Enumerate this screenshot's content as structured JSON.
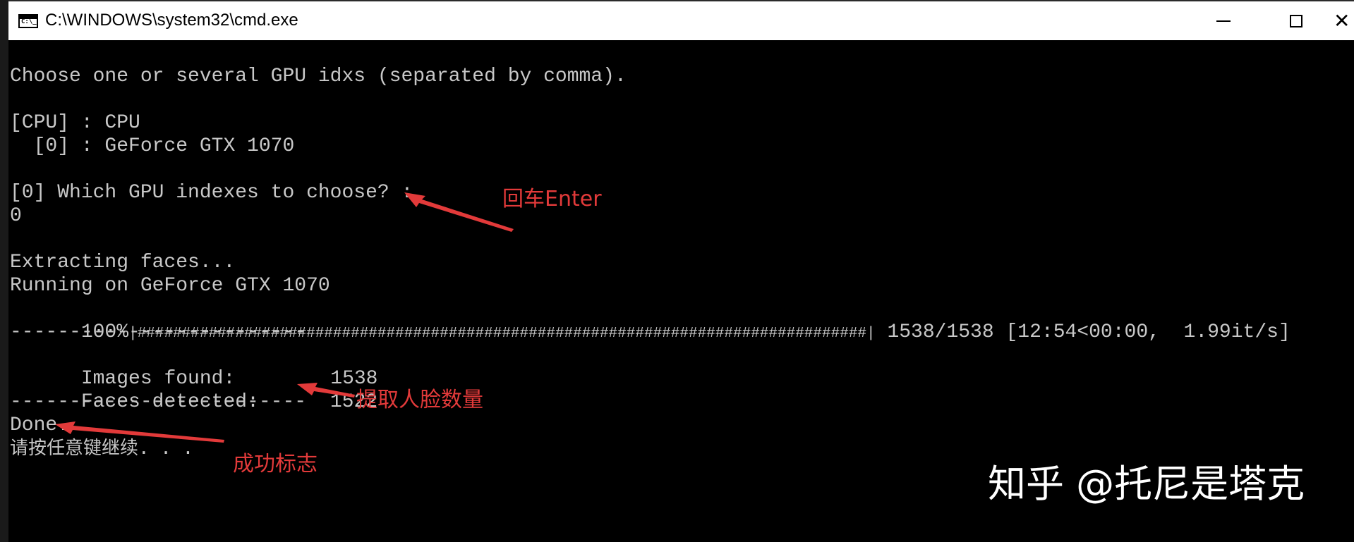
{
  "window": {
    "title": "C:\\WINDOWS\\system32\\cmd.exe",
    "icon": "cmd-console-icon",
    "icon_glyph": "C:\\_",
    "controls": {
      "minimize": "minimize-icon",
      "maximize": "maximize-icon",
      "close": "close-icon",
      "close_glyph": "✕"
    }
  },
  "console": {
    "prompt_line": "Choose one or several GPU idxs (separated by comma).",
    "devices": [
      "[CPU] : CPU",
      "  [0] : GeForce GTX 1070"
    ],
    "question": "[0] Which GPU indexes to choose? :",
    "answer": "0",
    "extracting": "Extracting faces...",
    "running_on": "Running on GeForce GTX 1070",
    "progress": {
      "percent_label": "100%",
      "bar_text": "|##################################################################################|",
      "count": "1538/1538",
      "timing": "[12:54<00:00,  1.99it/s]",
      "fraction": 1.0
    },
    "separator": "-------------------------",
    "images_found_label": "Images found:",
    "images_found_value": "1538",
    "faces_detected_label": "Faces detected:",
    "faces_detected_value": "1522",
    "done": "Done.",
    "press_key": "请按任意键继续. . ."
  },
  "annotations": {
    "enter_note": "回车Enter",
    "faces_note": "提取人脸数量",
    "success_note": "成功标志",
    "color": "#e23a3a"
  },
  "watermark": "知乎 @托尼是塔克",
  "colors": {
    "console_bg": "#000000",
    "console_text": "#c8c8c8",
    "titlebar_bg": "#ffffff"
  }
}
